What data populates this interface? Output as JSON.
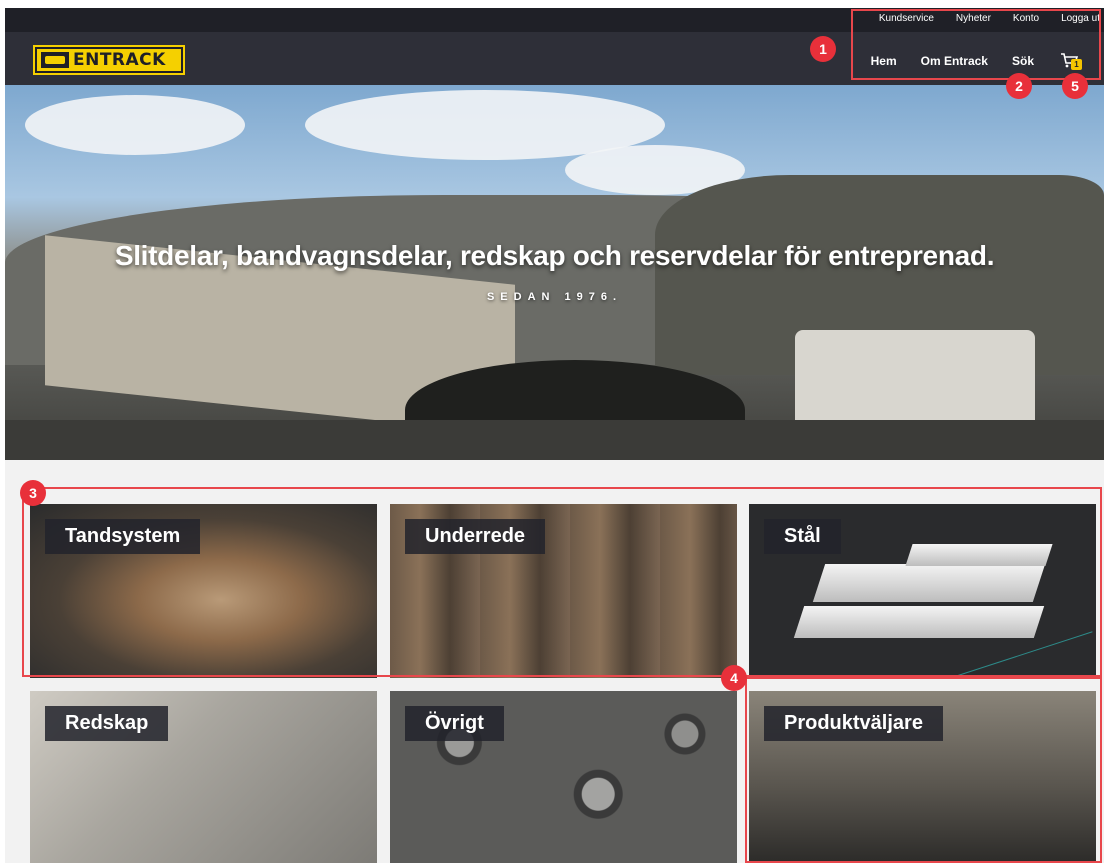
{
  "header": {
    "logo_text": "ENTRACK",
    "top_links": [
      "Kundservice",
      "Nyheter",
      "Konto",
      "Logga ut"
    ],
    "nav_links": [
      "Hem",
      "Om Entrack",
      "Sök"
    ],
    "cart_count": "1"
  },
  "hero": {
    "title": "Slitdelar, bandvagnsdelar, redskap och reservdelar för entreprenad.",
    "subtitle": "SEDAN 1976."
  },
  "categories": [
    "Tandsystem",
    "Underrede",
    "Stål",
    "Redskap",
    "Övrigt",
    "Produktväljare"
  ],
  "annotations": [
    "1",
    "2",
    "3",
    "4",
    "5"
  ],
  "colors": {
    "header_bg": "#2e2f38",
    "top_strip_bg": "#1f2027",
    "brand_yellow": "#f5d000",
    "annotation_red": "#e8303a"
  }
}
